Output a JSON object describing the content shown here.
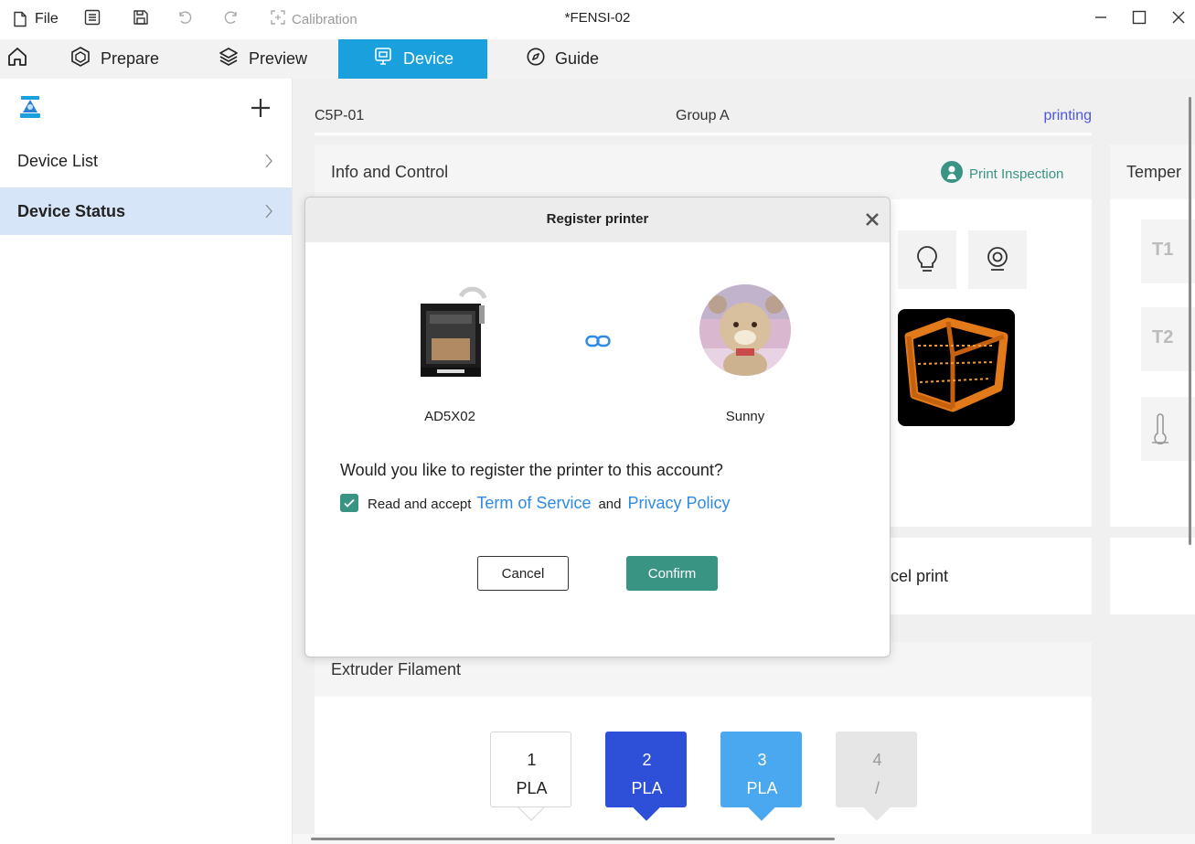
{
  "titlebar": {
    "file_label": "File",
    "calibration_label": "Calibration",
    "window_title": "*FENSI-02"
  },
  "nav": {
    "tabs": [
      {
        "label": "Prepare"
      },
      {
        "label": "Preview"
      },
      {
        "label": "Device"
      },
      {
        "label": "Guide"
      }
    ],
    "active_tab": "Device"
  },
  "sidebar": {
    "items": [
      {
        "label": "Device List"
      },
      {
        "label": "Device Status"
      }
    ]
  },
  "device_header": {
    "name": "C5P-01",
    "group": "Group A",
    "status": "printing"
  },
  "info_panel": {
    "title": "Info and Control",
    "inspection_label": "Print Inspection"
  },
  "temperature_panel": {
    "title": "Temper",
    "t1_label": "T1",
    "t2_label": "T2"
  },
  "cancel_print_label": "cel print",
  "filament_panel": {
    "title": "Extruder  Filament",
    "slots": [
      {
        "number": "1",
        "material": "PLA",
        "color": "#ffffff",
        "text_color": "#222222"
      },
      {
        "number": "2",
        "material": "PLA",
        "color": "#2e50d8",
        "text_color": "#ffffff"
      },
      {
        "number": "3",
        "material": "PLA",
        "color": "#4aa8f0",
        "text_color": "#ffffff"
      },
      {
        "number": "4",
        "material": "/",
        "color": "#e6e6e6",
        "text_color": "#999999"
      }
    ]
  },
  "modal": {
    "title": "Register printer",
    "printer_name": "AD5X02",
    "user_name": "Sunny",
    "question": "Would you like to register the printer to this account?",
    "accept_prefix": "Read and accept",
    "terms_link": "Term of Service",
    "and_text": "and",
    "privacy_link": "Privacy Policy",
    "checkbox_checked": true,
    "cancel_label": "Cancel",
    "confirm_label": "Confirm"
  },
  "colors": {
    "accent_blue": "#1aa0dc",
    "teal": "#3a9484",
    "status_purple": "#4a56e0",
    "link_blue": "#2d8ae6"
  }
}
